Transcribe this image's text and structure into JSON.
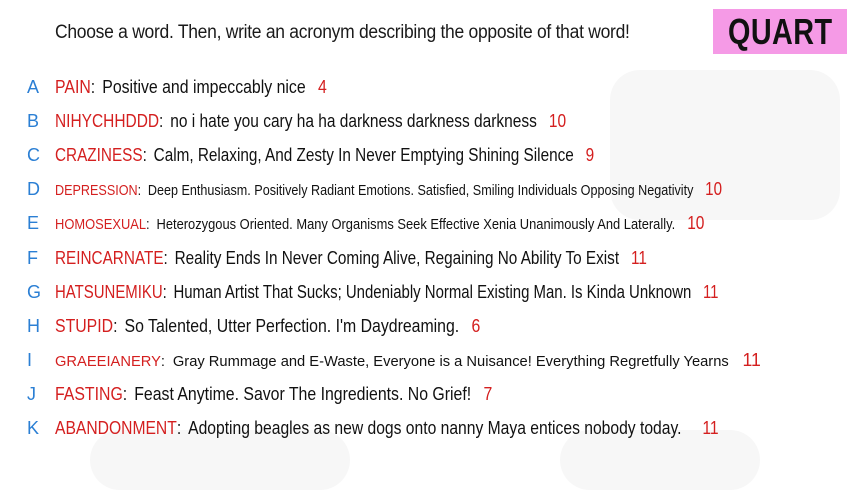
{
  "prompt": "Choose a word. Then, write an acronym describing the opposite of that word!",
  "logo": {
    "text": "QUART",
    "bg_color": "#f59ae6"
  },
  "colors": {
    "letter": "#2b7fd4",
    "word": "#d41f1f",
    "score": "#d41f1f",
    "text": "#111111"
  },
  "entries": [
    {
      "letter": "A",
      "word": "PAIN",
      "acronym": "Positive and impeccably nice",
      "score": "4"
    },
    {
      "letter": "B",
      "word": "NIHYCHHDDD",
      "acronym": "no i hate you cary ha ha darkness darkness darkness",
      "score": "10"
    },
    {
      "letter": "C",
      "word": "CRAZINESS",
      "acronym": "Calm, Relaxing, And Zesty In Never Emptying Shining Silence",
      "score": "9"
    },
    {
      "letter": "D",
      "word": "DEPRESSION",
      "acronym": "Deep Enthusiasm. Positively Radiant Emotions. Satisfied, Smiling Individuals Opposing Negativity",
      "score": "10"
    },
    {
      "letter": "E",
      "word": "HOMOSEXUAL",
      "acronym": "Heterozygous Oriented. Many Organisms Seek Effective Xenia Unanimously And Laterally.",
      "score": "10"
    },
    {
      "letter": "F",
      "word": "REINCARNATE",
      "acronym": "Reality Ends In Never Coming Alive, Regaining No Ability To Exist",
      "score": "11"
    },
    {
      "letter": "G",
      "word": "HATSUNEMIKU",
      "acronym": "Human Artist That Sucks; Undeniably Normal Existing Man. Is Kinda Unknown",
      "score": "11"
    },
    {
      "letter": "H",
      "word": "STUPID",
      "acronym": "So Talented, Utter Perfection. I'm Daydreaming.",
      "score": "6"
    },
    {
      "letter": "I",
      "word": "GRAEEIANERY",
      "acronym": "Gray Rummage and E-Waste, Everyone is a Nuisance! Everything Regretfully Yearns",
      "score": "11"
    },
    {
      "letter": "J",
      "word": "FASTING",
      "acronym": "Feast Anytime. Savor The Ingredients. No Grief!",
      "score": "7"
    },
    {
      "letter": "K",
      "word": "ABANDONMENT",
      "acronym": "Adopting beagles as new dogs onto nanny Maya entices nobody today.",
      "score": "11"
    }
  ]
}
